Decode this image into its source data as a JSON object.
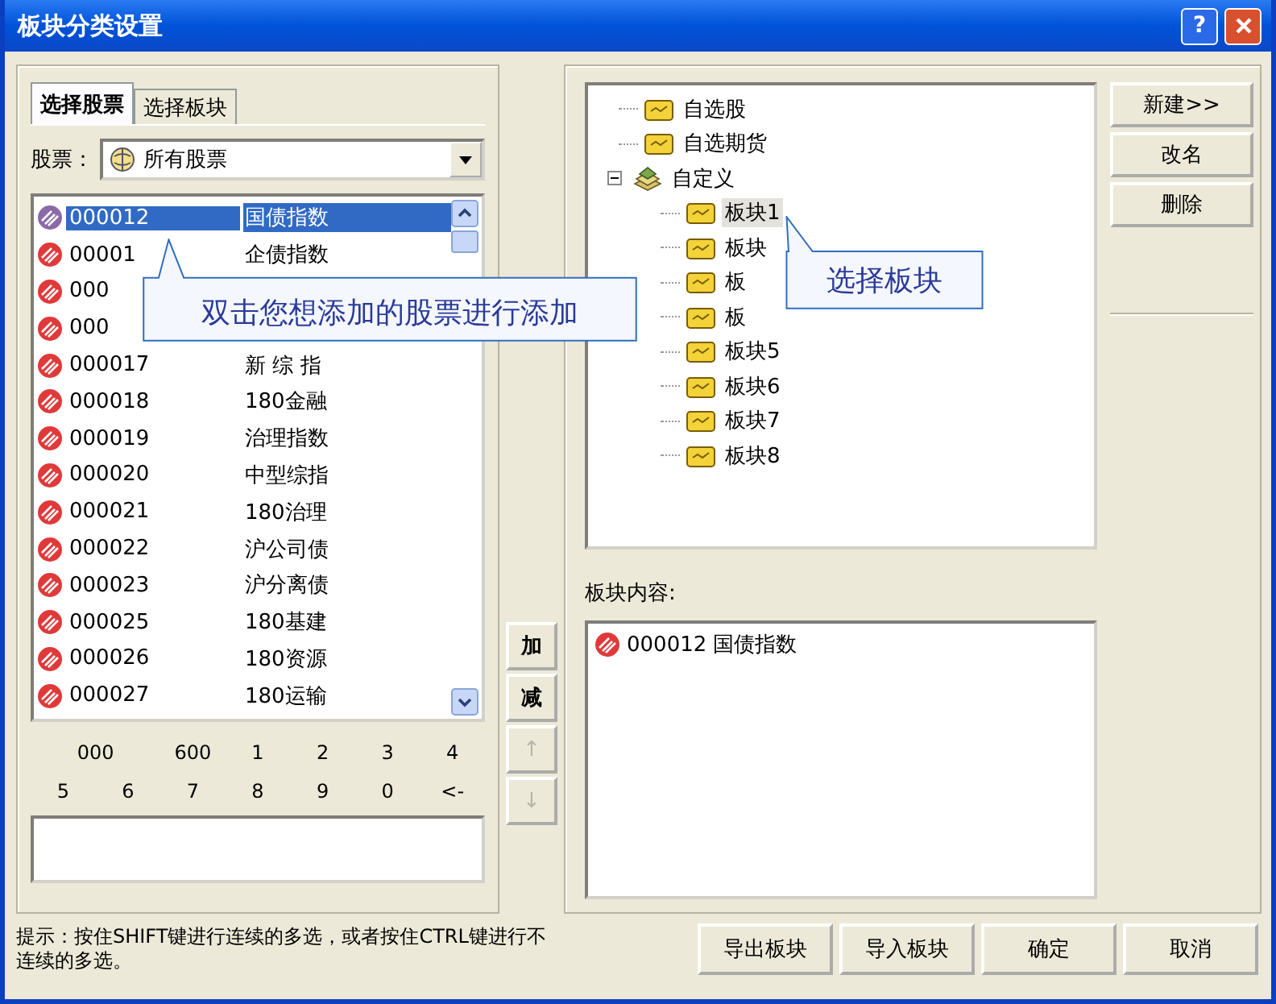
{
  "window": {
    "title": "板块分类设置",
    "help_label": "?"
  },
  "tabs": [
    {
      "label": "选择股票",
      "selected": true
    },
    {
      "label": "选择板块",
      "selected": false
    }
  ],
  "stock_filter": {
    "label": "股票：",
    "value": "所有股票"
  },
  "stocks": [
    {
      "code": "000012",
      "name": "国债指数",
      "selected": true
    },
    {
      "code": "00001",
      "name": "企债指数",
      "selected": false
    },
    {
      "code": "000",
      "selected": false
    },
    {
      "code": "000",
      "selected": false
    },
    {
      "code": "000017",
      "name": "新 综 指",
      "selected": false
    },
    {
      "code": "000018",
      "name": "180金融",
      "selected": false
    },
    {
      "code": "000019",
      "name": "治理指数",
      "selected": false
    },
    {
      "code": "000020",
      "name": "中型综指",
      "selected": false
    },
    {
      "code": "000021",
      "name": "180治理",
      "selected": false
    },
    {
      "code": "000022",
      "name": "沪公司债",
      "selected": false
    },
    {
      "code": "000023",
      "name": "沪分离债",
      "selected": false
    },
    {
      "code": "000025",
      "name": "180基建",
      "selected": false
    },
    {
      "code": "000026",
      "name": "180资源",
      "selected": false
    },
    {
      "code": "000027",
      "name": "180运输",
      "selected": false
    }
  ],
  "keypad": [
    "000",
    "600",
    "1",
    "2",
    "3",
    "4",
    "5",
    "6",
    "7",
    "8",
    "9",
    "0",
    "<-"
  ],
  "move_buttons": [
    {
      "label": "加",
      "disabled": false
    },
    {
      "label": "减",
      "disabled": false
    },
    {
      "label": "↑",
      "disabled": true
    },
    {
      "label": "↓",
      "disabled": true
    }
  ],
  "tree": [
    {
      "label": "自选股",
      "selected": false
    },
    {
      "label": "自选期货",
      "selected": false
    },
    {
      "label": "自定义",
      "selected": false,
      "expanded": true,
      "children": [
        {
          "label": "板块1",
          "selected": true
        },
        {
          "label": "板块",
          "selected": false
        },
        {
          "label": "板",
          "selected": false
        },
        {
          "label": "板",
          "selected": false
        },
        {
          "label": "板块5",
          "selected": false
        },
        {
          "label": "板块6",
          "selected": false
        },
        {
          "label": "板块7",
          "selected": false
        },
        {
          "label": "板块8",
          "selected": false
        }
      ]
    }
  ],
  "block_buttons": [
    "新建>>",
    "改名",
    "删除"
  ],
  "contents": {
    "label": "板块内容:",
    "items": [
      {
        "code": "000012",
        "name": "国债指数"
      }
    ]
  },
  "hint": "提示：按住SHIFT键进行连续的多选，或者按住CTRL键进行不连续的多选。",
  "footer_buttons": [
    "导出板块",
    "导入板块",
    "确定",
    "取消"
  ],
  "callouts": [
    {
      "text": "双击您想添加的股票进行添加"
    },
    {
      "text": "选择板块"
    }
  ]
}
